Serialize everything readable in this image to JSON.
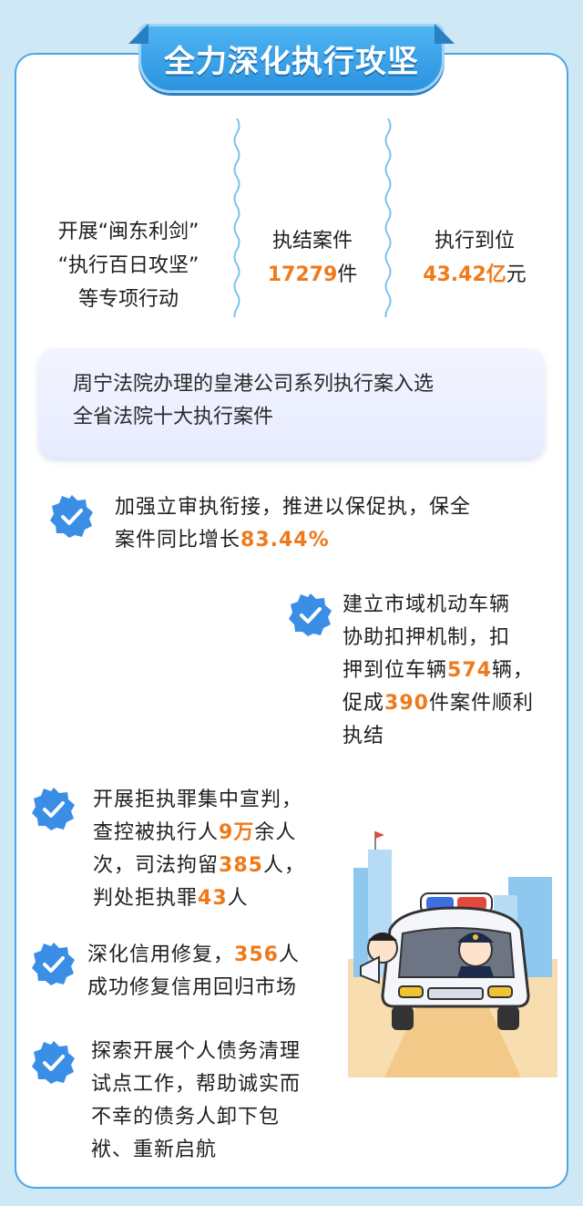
{
  "banner": {
    "title": "全力深化执行攻坚"
  },
  "stats": {
    "campaign": {
      "line1": "开展“闽东利剑”",
      "line2": "“执行百日攻坚”",
      "line3": "等专项行动"
    },
    "cases": {
      "label": "执结案件",
      "value": "17279",
      "unit": "件"
    },
    "money": {
      "label": "执行到位",
      "value": "43.42亿",
      "unit": "元"
    }
  },
  "highlight": {
    "line1": "周宁法院办理的皇港公司系列执行案入选",
    "line2": "全省法院十大执行案件"
  },
  "items": {
    "item1": {
      "line1": "加强立审执衔接，推进以保促执，保全",
      "line2_pre": "案件同比增长",
      "value": "83.44%"
    },
    "item2": {
      "line1": "建立市域机动车辆",
      "line2": "协助扣押机制，扣",
      "line3_pre": "押到位车辆",
      "value1": "574",
      "line3_post": "辆，",
      "line4_pre": "促成",
      "value2": "390",
      "line4_post": "件案件顺利",
      "line5": "执结"
    },
    "item3": {
      "line1": "开展拒执罪集中宣判，",
      "line2_pre": "查控被执行人",
      "value1": "9万",
      "line2_post": "余人",
      "line3_pre": "次，司法拘留",
      "value2": "385",
      "line3_post": "人，",
      "line4_pre": "判处拒执罪",
      "value3": "43",
      "line4_post": "人"
    },
    "item4": {
      "line1_pre": "深化信用修复，",
      "value": "356",
      "line1_post": "人",
      "line2": "成功修复信用回归市场"
    },
    "item5": {
      "line1": "探索开展个人债务清理",
      "line2": "试点工作，帮助诚实而",
      "line3": "不幸的债务人卸下包",
      "line4": "袱、重新启航"
    }
  },
  "colors": {
    "accent": "#f07a1a",
    "badge": "#3a8ee6",
    "border": "#4aa6e6",
    "background": "#cfe8f6"
  },
  "icons": {
    "badge": "check-badge-icon",
    "illustration": "police-car-illustration"
  }
}
